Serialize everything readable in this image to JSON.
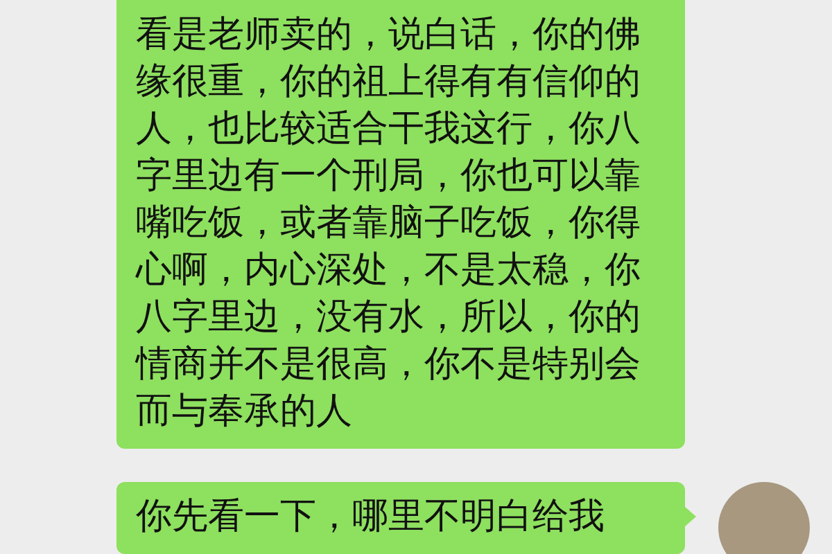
{
  "messages": [
    {
      "text": "看是老师卖的，说白话，你的佛缘很重，你的祖上得有有信仰的人，也比较适合干我这行，你八字里边有一个刑局，你也可以靠嘴吃饭，或者靠脑子吃饭，你得心啊，内心深处，不是太稳，你八字里边，没有水，所以，你的情商并不是很高，你不是特别会而与奉承的人",
      "avatar": false
    },
    {
      "text": "你先看一下，哪里不明白给我",
      "avatar": true
    }
  ]
}
